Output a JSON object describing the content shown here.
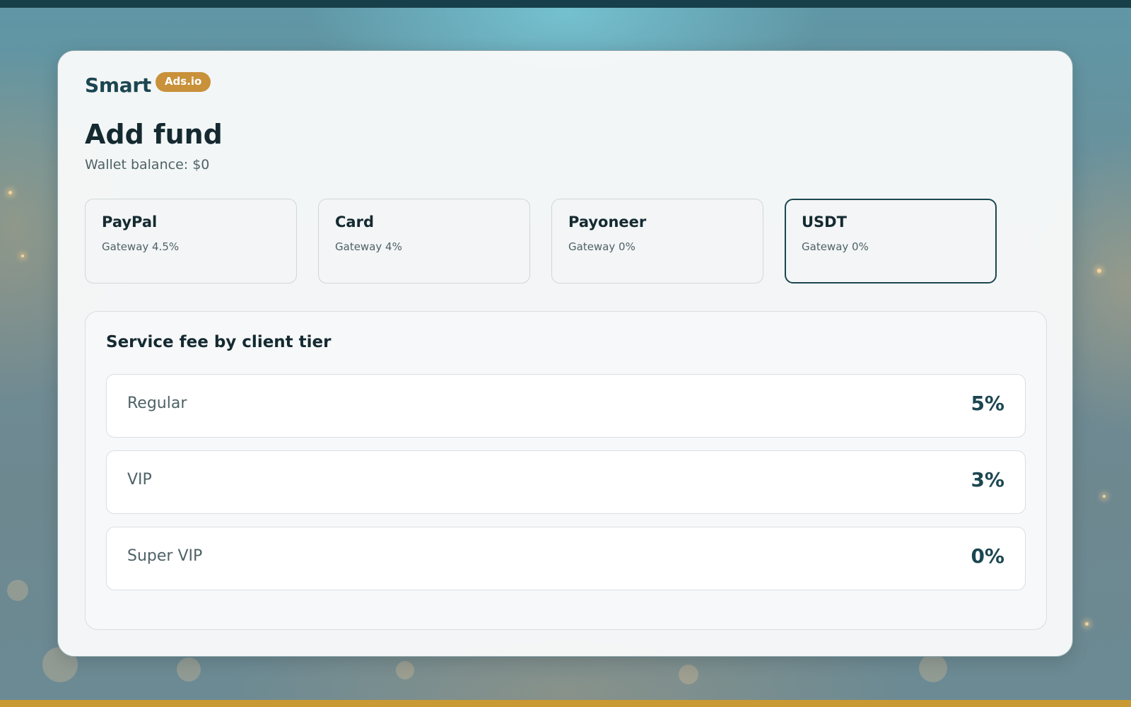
{
  "brand": {
    "name": "Smart",
    "badge": "Ads.io"
  },
  "page": {
    "title": "Add fund",
    "wallet_balance": "Wallet balance: $0"
  },
  "payment_methods": [
    {
      "name": "PayPal",
      "fee": "Gateway 4.5%",
      "selected": false
    },
    {
      "name": "Card",
      "fee": "Gateway 4%",
      "selected": false
    },
    {
      "name": "Payoneer",
      "fee": "Gateway 0%",
      "selected": false
    },
    {
      "name": "USDT",
      "fee": "Gateway 0%",
      "selected": true
    }
  ],
  "fees": {
    "title": "Service fee by client tier",
    "tiers": [
      {
        "name": "Regular",
        "fee": "5%"
      },
      {
        "name": "VIP",
        "fee": "3%"
      },
      {
        "name": "Super VIP",
        "fee": "0%"
      }
    ]
  },
  "colors": {
    "brand_dark": "#1b4651",
    "brand_gold": "#c8913a",
    "top_bar": "#173f4a",
    "bottom_bar": "#c99a34"
  }
}
